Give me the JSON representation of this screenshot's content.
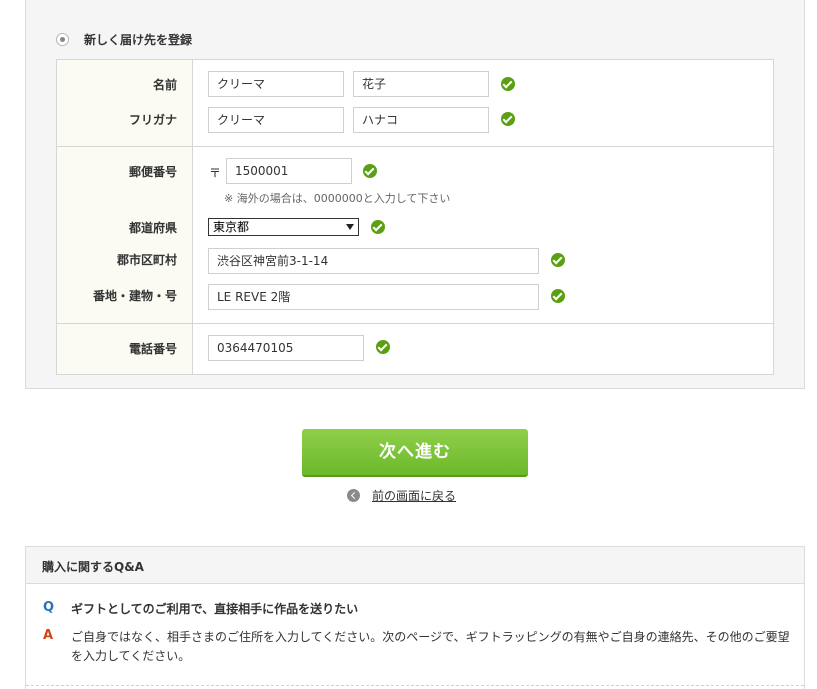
{
  "address_option": {
    "label": "新しく届け先を登録"
  },
  "form": {
    "name": {
      "label": "名前",
      "last": "クリーマ",
      "first": "花子"
    },
    "furigana": {
      "label": "フリガナ",
      "last": "クリーマ",
      "first": "ハナコ"
    },
    "postal": {
      "label": "郵便番号",
      "mark": "〒",
      "value": "1500001",
      "note": "※ 海外の場合は、0000000と入力して下さい"
    },
    "prefecture": {
      "label": "都道府県",
      "value": "東京都"
    },
    "city": {
      "label": "郡市区町村",
      "value": "渋谷区神宮前3-1-14"
    },
    "street": {
      "label": "番地・建物・号",
      "value": "LE REVE 2階"
    },
    "phone": {
      "label": "電話番号",
      "value": "0364470105"
    }
  },
  "actions": {
    "next_label": "次へ進む",
    "back_label": "前の画面に戻る"
  },
  "qa": {
    "title": "購入に関するQ&A",
    "q_mark": "Q",
    "a_mark": "A",
    "question": "ギフトとしてのご利用で、直接相手に作品を送りたい",
    "answer": "ご自身ではなく、相手さまのご住所を入力してください。次のページで、ギフトラッピングの有無やご自身の連絡先、その他のご要望を入力してください。"
  },
  "colors": {
    "accent_green": "#6cb82a",
    "check_green": "#5aa012",
    "q_blue": "#2a72b8",
    "a_red": "#d2461c"
  }
}
